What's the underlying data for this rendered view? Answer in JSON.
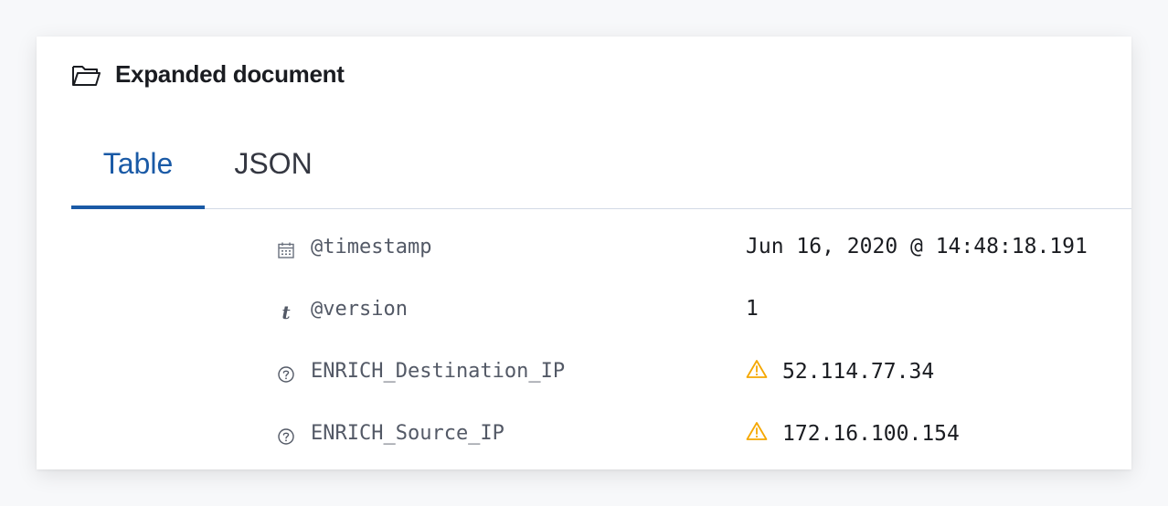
{
  "panel": {
    "title": "Expanded document",
    "title_icon": "folder-open-icon"
  },
  "tabs": [
    {
      "label": "Table",
      "selected": true
    },
    {
      "label": "JSON",
      "selected": false
    }
  ],
  "fields": [
    {
      "type_icon": "calendar-icon",
      "name": "@timestamp",
      "value": "Jun 16, 2020 @ 14:48:18.191",
      "warning": false
    },
    {
      "type_icon": "string-type-icon",
      "type_glyph": "t",
      "name": "@version",
      "value": "1",
      "warning": false
    },
    {
      "type_icon": "question-circle-icon",
      "name": "ENRICH_Destination_IP",
      "value": "52.114.77.34",
      "warning": true
    },
    {
      "type_icon": "question-circle-icon",
      "name": "ENRICH_Source_IP",
      "value": "172.16.100.154",
      "warning": true
    }
  ],
  "colors": {
    "accent": "#1a5aa6",
    "warning": "#f5a700",
    "text": "#1a1c21",
    "muted": "#535966"
  }
}
